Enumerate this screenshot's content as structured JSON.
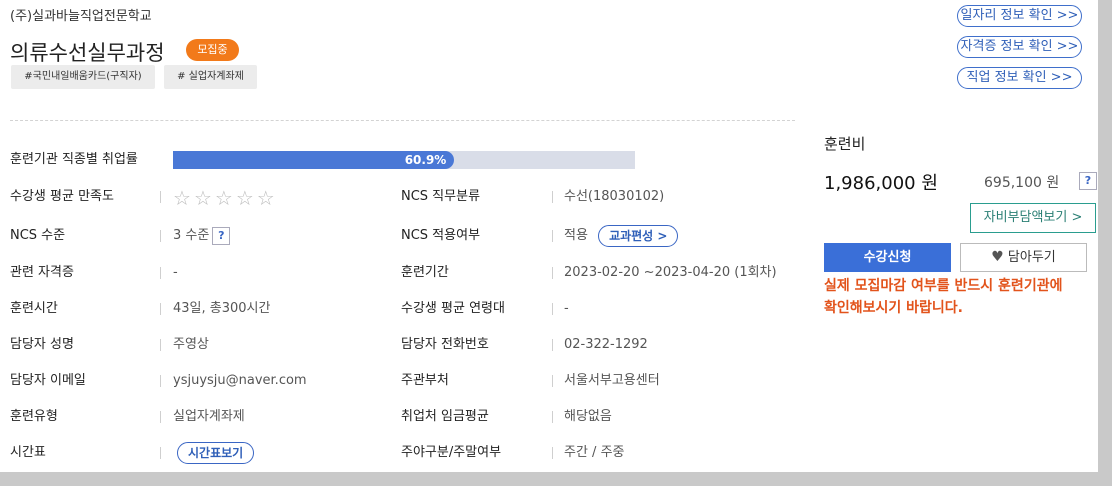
{
  "institution": "(주)실과바늘직업전문학교",
  "course_title": "의류수선실무과정",
  "status_badge": "모집중",
  "tags": [
    "#국민내일배움카드(구직자)",
    "# 실업자계좌제"
  ],
  "links": [
    "일자리 정보 확인 >>",
    "자격증 정보 확인 >>",
    "직업 정보 확인 >>"
  ],
  "employment_rate": {
    "label": "훈련기관 직종별 취업률",
    "value": 60.9,
    "text": "60.9%"
  },
  "satisfaction": {
    "label": "수강생 평균 만족도",
    "rating": 0,
    "max": 5
  },
  "rows": [
    {
      "l1": "NCS 수준",
      "v1": "3 수준",
      "l2": "NCS 적용여부",
      "v2": "적용",
      "btn2": "교과편성 >"
    },
    {
      "l1": "관련 자격증",
      "v1": "-",
      "l2": "훈련기간",
      "v2": "2023-02-20 ~2023-04-20 (1회차)"
    },
    {
      "l1": "훈련시간",
      "v1": "43일, 총300시간",
      "l2": "수강생 평균 연령대",
      "v2": "-"
    },
    {
      "l1": "담당자 성명",
      "v1": "주영상",
      "l2": "담당자 전화번호",
      "v2": "02-322-1292"
    },
    {
      "l1": "담당자 이메일",
      "v1": "ysjuysju@naver.com",
      "l2": "주관부처",
      "v2": "서울서부고용센터"
    },
    {
      "l1": "훈련유형",
      "v1": "실업자계좌제",
      "l2": "취업처 임금평균",
      "v2": "해당없음"
    },
    {
      "l1": "시간표",
      "btn1": "시간표보기",
      "l2": "주야구분/주말여부",
      "v2": "주간 / 주중"
    }
  ],
  "ncs_category": {
    "label": "NCS 직무분류",
    "value": "수선(18030102)"
  },
  "fee": {
    "label": "훈련비",
    "price": "1,986,000 원",
    "self_pay": "695,100 원",
    "help": "?",
    "self_pay_button": "자비부담액보기 >",
    "apply_button": "수강신청",
    "save_button": "담아두기",
    "notice": "실제 모집마감 여부를 반드시 훈련기관에 확인해보시기 바랍니다."
  },
  "colors": {
    "accent": "#3a6fd8",
    "badge": "#f27a1a",
    "notice": "#e2531b",
    "bar_track": "#d9dde8"
  }
}
